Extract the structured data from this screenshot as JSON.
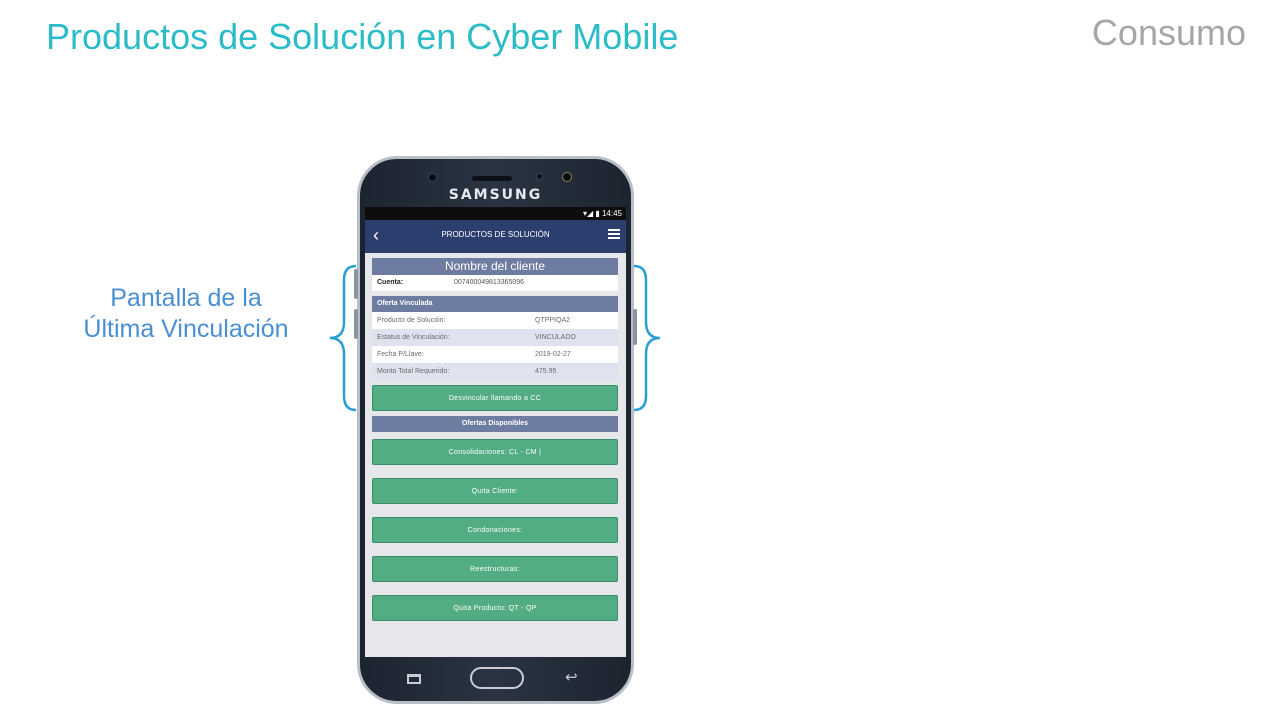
{
  "slide": {
    "title": "Productos de Solución en Cyber Mobile",
    "tag": "Consumo",
    "caption_line1": "Pantalla de la",
    "caption_line2": "Última Vinculación",
    "accent_color": "#2bbcc7",
    "caption_color": "#4a8fd1",
    "brace_color": "#2a9fd6"
  },
  "phone": {
    "brand": "SAMSUNG",
    "status_time": "14:45",
    "app_title": "PRODUCTOS DE SOLUCIÓN",
    "client_name": "Nombre del cliente",
    "account_label": "Cuenta:",
    "account_value": "007400049813365096",
    "linked_section": "Oferta Vinculada",
    "linked_rows": [
      {
        "key": "Producto de Solución:",
        "value": "QTPPIQA2"
      },
      {
        "key": "Estatus de Vinculación:",
        "value": "VINCULADO"
      },
      {
        "key": "Fecha P/Llave:",
        "value": "2019-02-27"
      },
      {
        "key": "Monto Total Requerido:",
        "value": "475.95"
      }
    ],
    "unlink_button": "Desvincular llamando a CC",
    "offers_section": "Ofertas Disponibles",
    "offer_buttons": [
      "Consolidaciones: CL - CM |",
      "Quita Cliente:",
      "Condonaciones:",
      "Reestructuras:",
      "Quita Producto: QT - QP"
    ],
    "header_color": "#2c3e6d",
    "button_color": "#53ad83"
  }
}
